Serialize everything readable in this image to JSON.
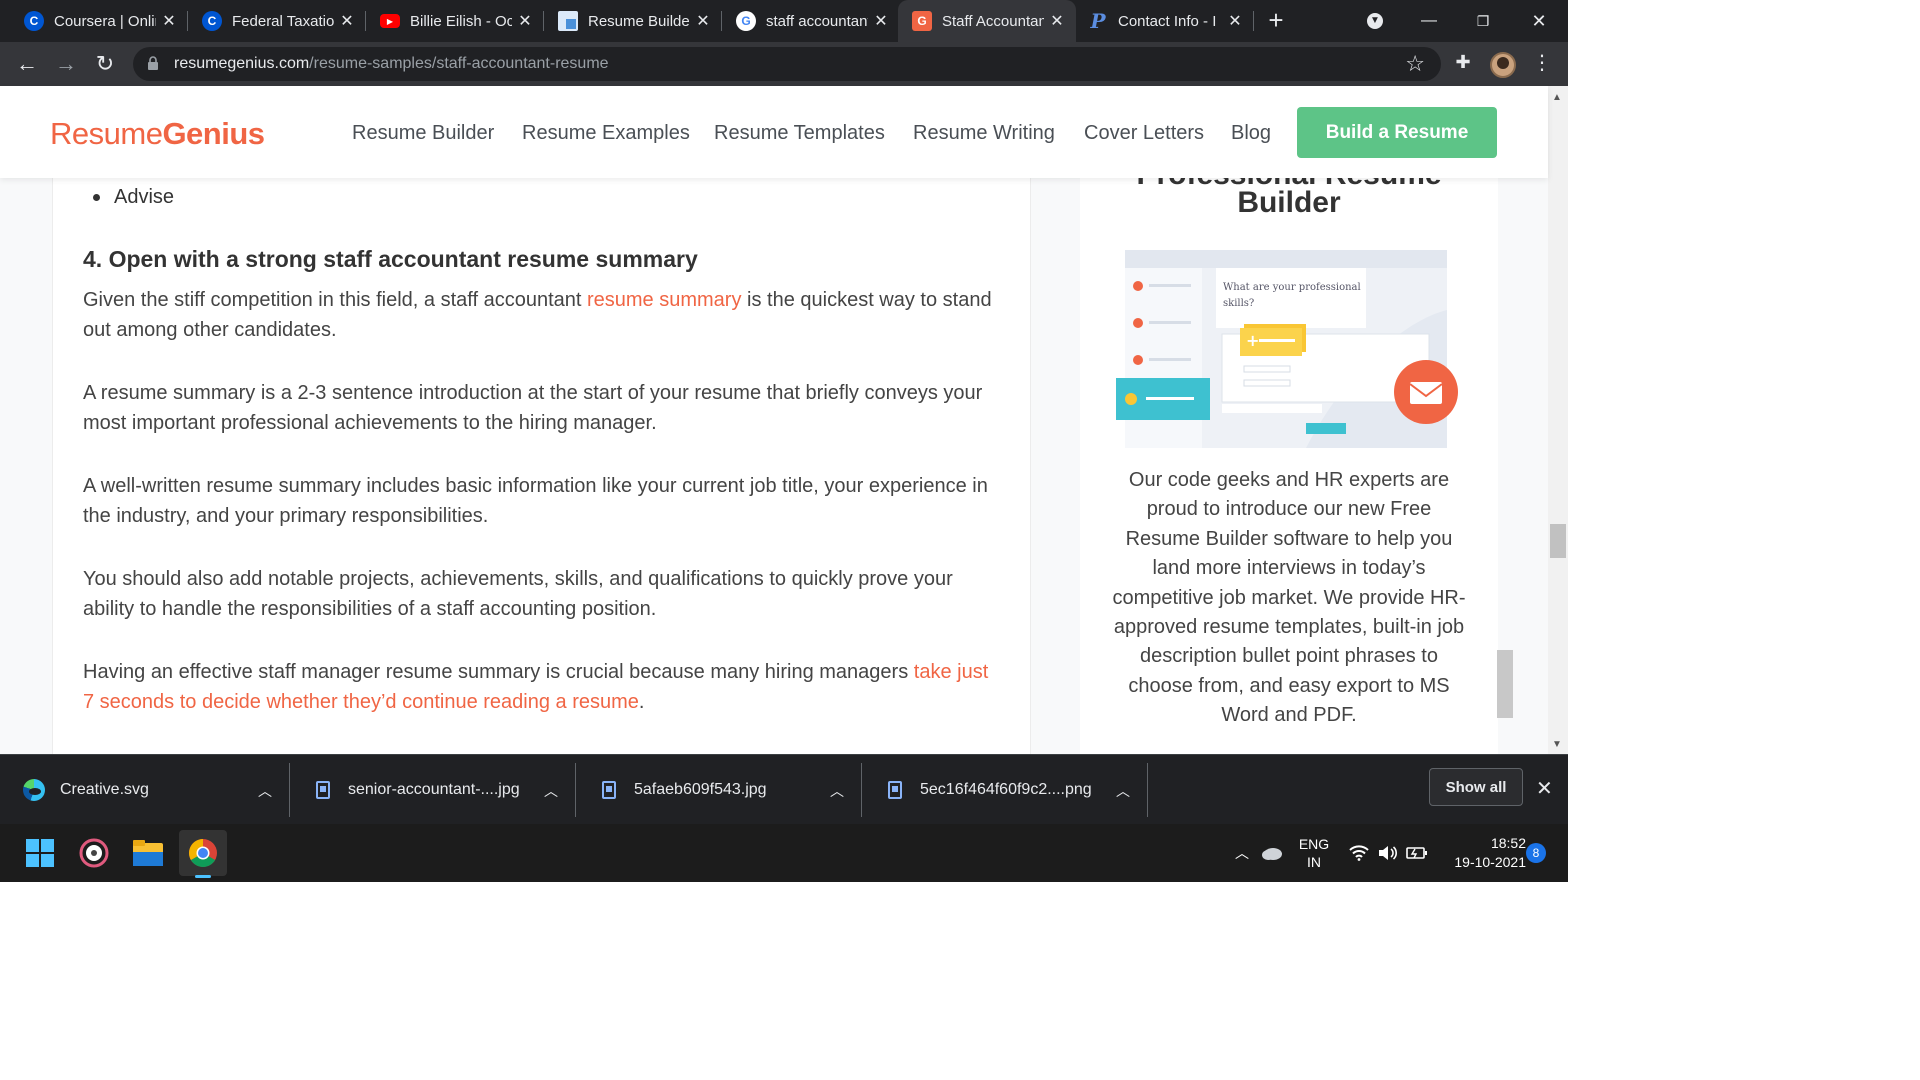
{
  "browser": {
    "tabs": [
      {
        "title": "Coursera | Online",
        "icon": "coursera-icon",
        "color": "#0056d2",
        "letter": "C"
      },
      {
        "title": "Federal Taxation",
        "icon": "coursera-icon",
        "color": "#0056d2",
        "letter": "C"
      },
      {
        "title": "Billie Eilish - Oc",
        "icon": "youtube-icon",
        "color": "#ff0000",
        "letter": "▶"
      },
      {
        "title": "Resume Builder",
        "icon": "resume-builder-icon",
        "color": "#4a90d9",
        "letter": "▪"
      },
      {
        "title": "staff accountant",
        "icon": "google-icon",
        "color": "#ffffff",
        "letter": "G"
      },
      {
        "title": "Staff Accountant",
        "icon": "resumegenius-icon",
        "color": "#f06544",
        "letter": "G"
      },
      {
        "title": "Contact Info - I",
        "icon": "p-icon",
        "color": "#2d5ea8",
        "letter": "P"
      }
    ],
    "address": {
      "domain": "resumegenius.com",
      "path": "/resume-samples/staff-accountant-resume"
    }
  },
  "site": {
    "logo_light": "Resume",
    "logo_bold": "Genius",
    "nav": [
      "Resume Builder",
      "Resume Examples",
      "Resume Templates",
      "Resume Writing",
      "Cover Letters",
      "Blog"
    ],
    "cta": "Build a Resume"
  },
  "article": {
    "bullet": "Advise",
    "heading": "4. Open with a strong staff accountant resume summary",
    "p1_a": "Given the stiff competition in this field, a staff accountant ",
    "p1_link": "resume summary",
    "p1_b": " is the quickest way to stand out among other candidates.",
    "p2": "A resume summary is a 2-3 sentence introduction at the start of your resume that briefly conveys your most important professional achievements to the hiring manager.",
    "p3": "A well-written resume summary includes basic information like your current job title, your experience in the industry, and your primary responsibilities.",
    "p4": "You should also add notable projects, achievements, skills, and qualifications to quickly prove your ability to handle the responsibilities of a staff accounting position.",
    "p5_a": "Having an effective staff manager resume summary is crucial because many hiring managers ",
    "p5_link": "take just 7 seconds to decide whether they’d continue reading a resume",
    "p5_b": "."
  },
  "sidebar": {
    "title_cut": "Professional Resume",
    "title": "Builder",
    "illus_question": "What are your professional skills?",
    "text": "Our code geeks and HR experts are proud to introduce our new Free Resume Builder software to help you land more interviews in today’s competitive job market. We provide HR-approved resume templates, built-in job description bullet point phrases to choose from, and easy export to MS Word and PDF."
  },
  "downloads": [
    {
      "name": "Creative.svg",
      "icon": "edge-icon"
    },
    {
      "name": "senior-accountant-....jpg",
      "icon": "image-file-icon"
    },
    {
      "name": "5afaeb609f543.jpg",
      "icon": "image-file-icon"
    },
    {
      "name": "5ec16f464f60f9c2....png",
      "icon": "image-file-icon"
    }
  ],
  "show_all": "Show all",
  "taskbar": {
    "lang1": "ENG",
    "lang2": "IN",
    "time": "18:52",
    "date": "19-10-2021",
    "notifications": "8"
  }
}
